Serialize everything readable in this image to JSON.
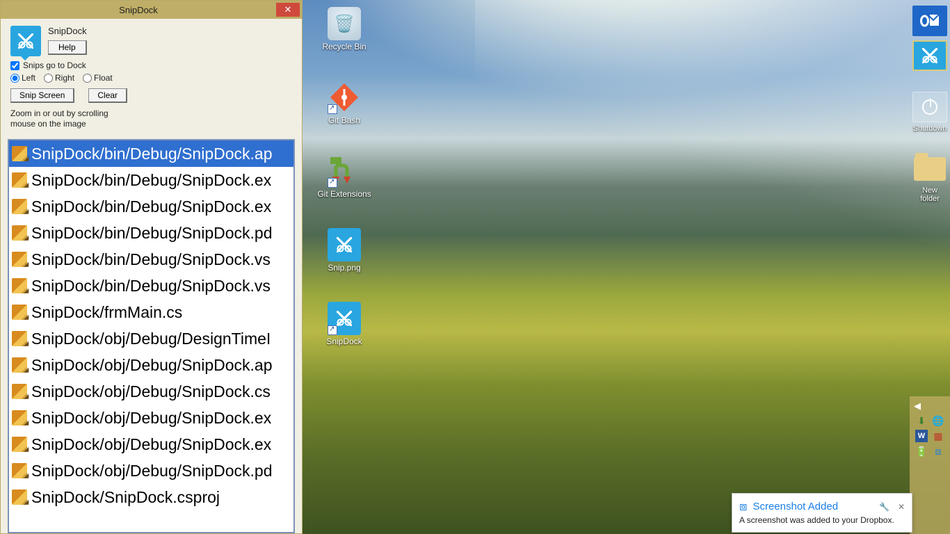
{
  "window": {
    "title": "SnipDock",
    "app_name": "SnipDock",
    "help_label": "Help",
    "dock_check_label": "Snips go to Dock",
    "dock_checked": true,
    "radios": {
      "left": "Left",
      "right": "Right",
      "float": "Float",
      "selected": "left"
    },
    "snip_button": "Snip Screen",
    "clear_button": "Clear",
    "hint": "Zoom in or out by scrolling mouse on the image",
    "list": [
      "SnipDock/bin/Debug/SnipDock.ap",
      "SnipDock/bin/Debug/SnipDock.ex",
      "SnipDock/bin/Debug/SnipDock.ex",
      "SnipDock/bin/Debug/SnipDock.pd",
      "SnipDock/bin/Debug/SnipDock.vs",
      "SnipDock/bin/Debug/SnipDock.vs",
      "SnipDock/frmMain.cs",
      "SnipDock/obj/Debug/DesignTimeI",
      "SnipDock/obj/Debug/SnipDock.ap",
      "SnipDock/obj/Debug/SnipDock.cs",
      "SnipDock/obj/Debug/SnipDock.ex",
      "SnipDock/obj/Debug/SnipDock.ex",
      "SnipDock/obj/Debug/SnipDock.pd",
      "SnipDock/SnipDock.csproj"
    ],
    "selected_index": 0
  },
  "desktop_icons": [
    {
      "name": "Recycle Bin"
    },
    {
      "name": "Git Bash"
    },
    {
      "name": "Git Extensions"
    },
    {
      "name": "Snip.png"
    },
    {
      "name": "SnipDock"
    }
  ],
  "right_dock": {
    "items": [
      {
        "name": "Outlook",
        "label": ""
      },
      {
        "name": "SnipDock",
        "label": ""
      },
      {
        "name": "Shutdown",
        "label": "Shutdown"
      },
      {
        "name": "New folder",
        "label": "New folder"
      }
    ]
  },
  "toast": {
    "title": "Screenshot Added",
    "body": "A screenshot was added to your Dropbox."
  }
}
